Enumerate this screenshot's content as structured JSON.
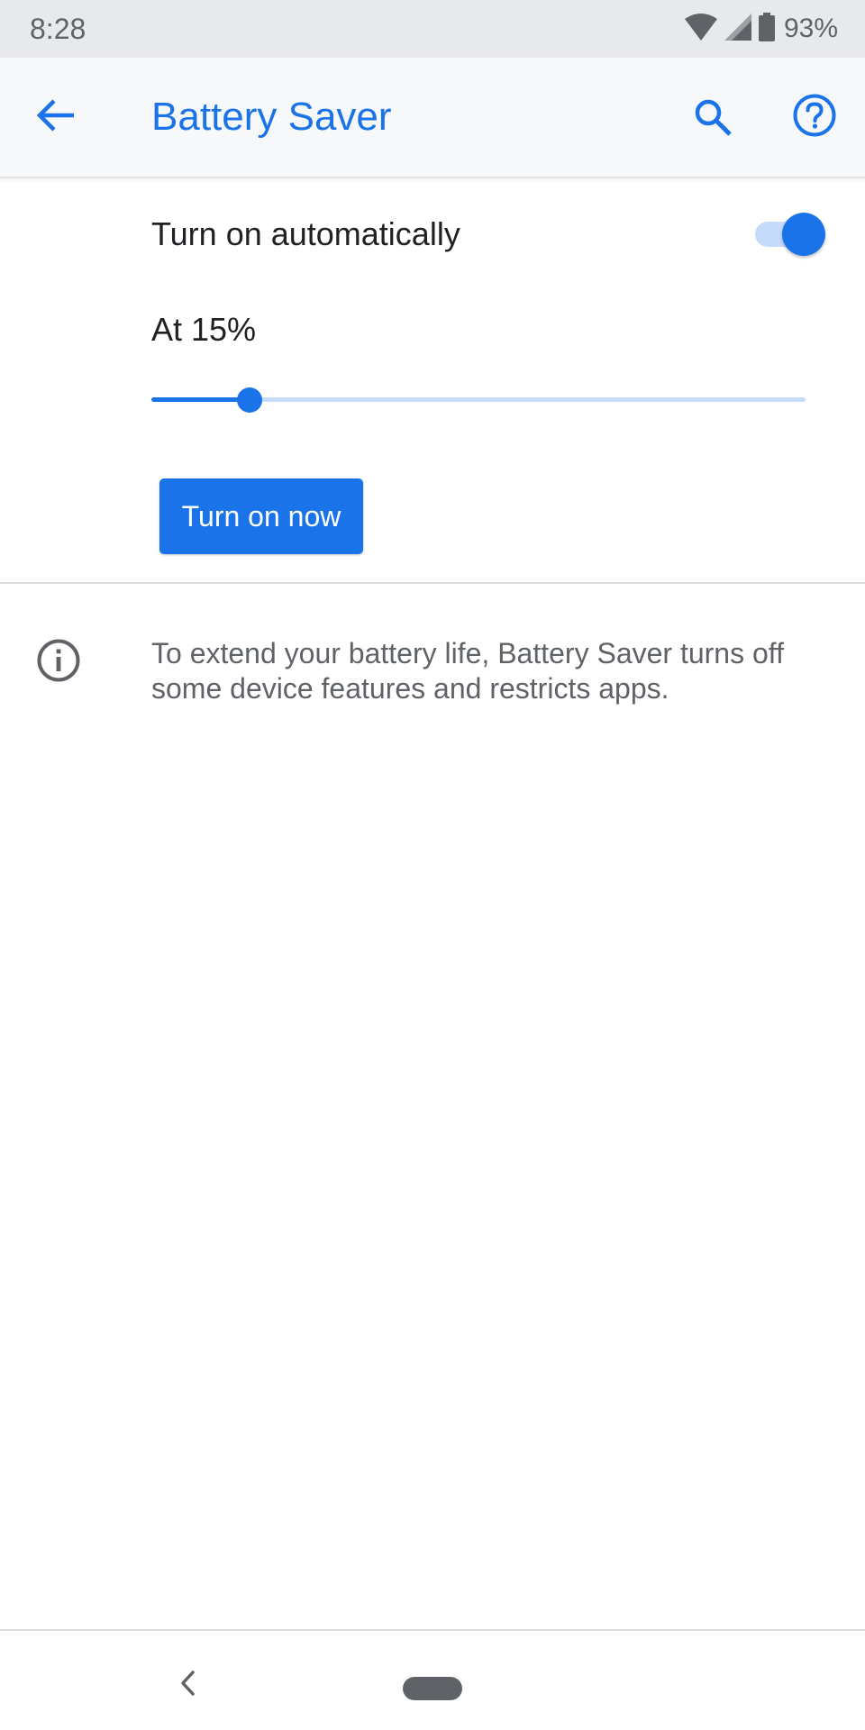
{
  "status_bar": {
    "time": "8:28",
    "battery_percent": "93%",
    "icons": [
      "wifi-icon",
      "cell-signal-icon",
      "battery-icon"
    ]
  },
  "app_bar": {
    "title": "Battery Saver",
    "back_icon": "arrow-back-icon",
    "search_icon": "search-icon",
    "help_icon": "help-circle-icon"
  },
  "auto_schedule": {
    "label": "Turn on automatically",
    "enabled": true
  },
  "threshold": {
    "label": "At 15%",
    "value_fraction": 0.15
  },
  "actions": {
    "turn_on_now_label": "Turn on now"
  },
  "footer": {
    "info_icon": "info-icon",
    "description": "To extend your battery life, Battery Saver turns off some device features and restricts apps."
  },
  "navigation": {
    "back_icon": "nav-back-icon",
    "home_icon": "home-pill-icon"
  },
  "colors": {
    "accent": "#1a73e8",
    "accent_light": "#c6dafc",
    "text_primary": "#202124",
    "text_secondary": "#5f6368",
    "status_bar_bg": "#e8e9eb",
    "app_bar_bg": "#f7f8f9"
  }
}
